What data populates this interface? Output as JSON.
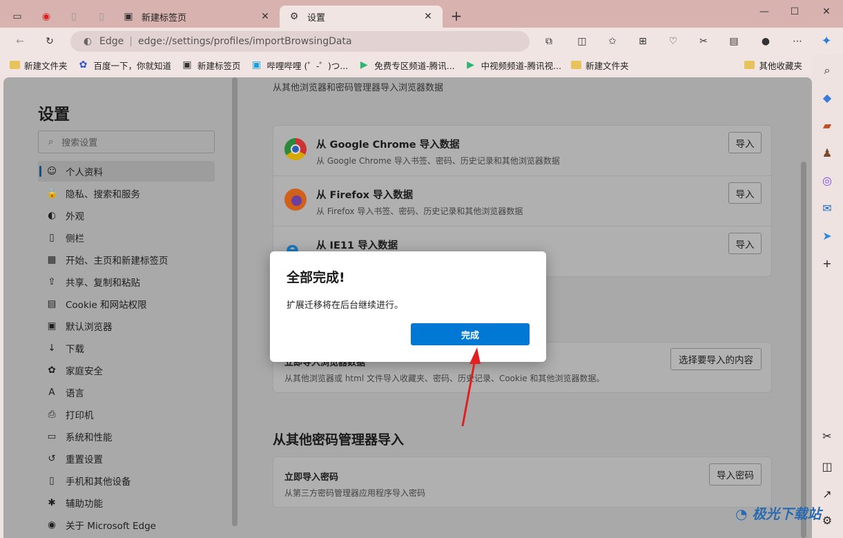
{
  "tabs": [
    {
      "label": "新建标签页"
    },
    {
      "label": "设置"
    }
  ],
  "address": {
    "site_label": "Edge",
    "url": "edge://settings/profiles/importBrowsingData"
  },
  "bookmarks": [
    "新建文件夹",
    "百度一下，你就知道",
    "新建标签页",
    "哔哩哔哩 (゜-゜)つ...",
    "免费专区频道-腾讯...",
    "中视频频道-腾讯视...",
    "新建文件夹"
  ],
  "bookmarks_other": "其他收藏夹",
  "settings": {
    "title": "设置",
    "search_placeholder": "搜索设置",
    "nav": [
      "个人资料",
      "隐私、搜索和服务",
      "外观",
      "侧栏",
      "开始、主页和新建标签页",
      "共享、复制和粘贴",
      "Cookie 和网站权限",
      "默认浏览器",
      "下载",
      "家庭安全",
      "语言",
      "打印机",
      "系统和性能",
      "重置设置",
      "手机和其他设备",
      "辅助功能",
      "关于 Microsoft Edge"
    ]
  },
  "main": {
    "header": "从其他浏览器和密码管理器导入浏览器数据",
    "rows": [
      {
        "title": "从 Google Chrome 导入数据",
        "sub": "从 Google Chrome 导入书签、密码、历史记录和其他浏览器数据",
        "button": "导入"
      },
      {
        "title": "从 Firefox 导入数据",
        "sub": "从 Firefox 导入书签、密码、历史记录和其他浏览器数据",
        "button": "导入"
      },
      {
        "title": "从 IE11 导入数据",
        "button": "导入"
      }
    ],
    "other": {
      "title": "立即导入浏览器数据",
      "sub": "从其他浏览器或 html 文件导入收藏夹、密码、历史记录、Cookie 和其他浏览器数据。",
      "button": "选择要导入的内容"
    },
    "pw_section": "从其他密码管理器导入",
    "pw": {
      "title": "立即导入密码",
      "sub": "从第三方密码管理器应用程序导入密码",
      "button": "导入密码"
    }
  },
  "dialog": {
    "title": "全部完成!",
    "message": "扩展迁移将在后台继续进行。",
    "button": "完成"
  },
  "watermark": "极光下载站"
}
